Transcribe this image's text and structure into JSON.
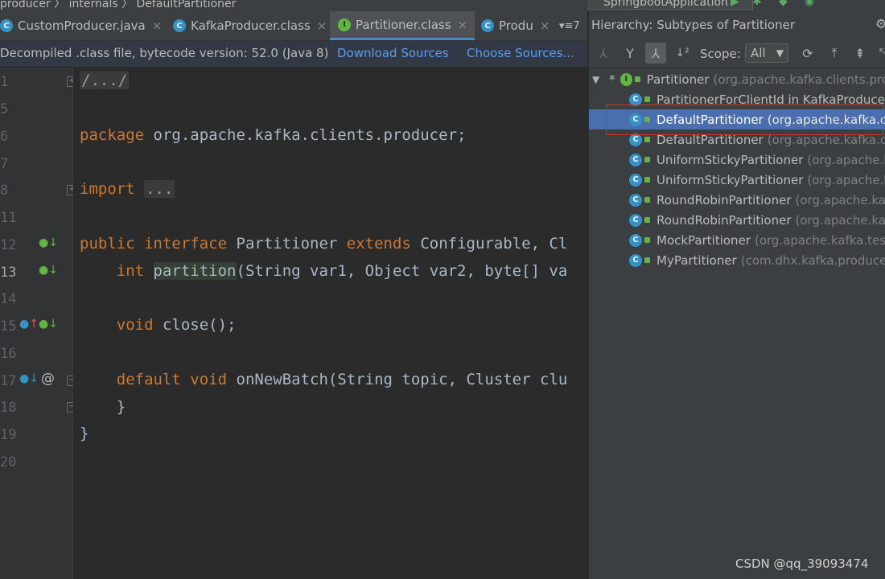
{
  "breadcrumb": {
    "text": "producer 〉 internals 〉 DefaultPartitioner"
  },
  "run_config": "SpringbootApplication",
  "tabs": [
    {
      "label": "CustomProducer.java",
      "icon": "C"
    },
    {
      "label": "KafkaProducer.class",
      "icon": "C"
    },
    {
      "label": "Partitioner.class",
      "icon": "I"
    },
    {
      "label": "Produ",
      "icon": "C"
    }
  ],
  "tab_overflow": "≡7",
  "banner": {
    "message": "Decompiled .class file, bytecode version: 52.0 (Java 8)",
    "download_sources": "Download Sources",
    "choose_sources": "Choose Sources..."
  },
  "editor": {
    "line_numbers": [
      "1",
      "5",
      "6",
      "7",
      "8",
      "11",
      "12",
      "13",
      "14",
      "15",
      "16",
      "17",
      "18",
      "19",
      "20"
    ],
    "collapsed_header": "/.../",
    "pkg_kw": "package",
    "pkg_name": " org.apache.kafka.clients.producer;",
    "import_kw": "import",
    "import_collapsed": "...",
    "line12_kw1": "public",
    "line12_kw2": "interface",
    "line12_name": "Partitioner",
    "line12_kw3": "extends",
    "line12_rest": "Configurable, Cl",
    "line13_kw": "int",
    "line13_method": "partition",
    "line13_rest": "(String var1, Object var2, byte[] va",
    "line15_kw": "void",
    "line15_rest": "close();",
    "line17_kw1": "default",
    "line17_kw2": "void",
    "line17_rest": "onNewBatch(String topic, Cluster clu",
    "brace_inner": "}",
    "brace_outer": "}"
  },
  "hierarchy": {
    "title": "Hierarchy:  Subtypes of Partitioner",
    "scope_label": "Scope:",
    "scope_value": "All",
    "root": {
      "name": "Partitioner",
      "pkg": "(org.apache.kafka.clients.pro"
    },
    "items": [
      {
        "name": "PartitionerForClientId in KafkaProducer",
        "pkg": ""
      },
      {
        "name": "DefaultPartitioner",
        "pkg": "(org.apache.kafka.cli",
        "selected": true
      },
      {
        "name": "DefaultPartitioner",
        "pkg": "(org.apache.kafka.cl"
      },
      {
        "name": "UniformStickyPartitioner",
        "pkg": "(org.apache.ka"
      },
      {
        "name": "UniformStickyPartitioner",
        "pkg": "(org.apache.ka"
      },
      {
        "name": "RoundRobinPartitioner",
        "pkg": "(org.apache.ka"
      },
      {
        "name": "RoundRobinPartitioner",
        "pkg": "(org.apache.ka"
      },
      {
        "name": "MockPartitioner",
        "pkg": "(org.apache.kafka.tes"
      },
      {
        "name": "MyPartitioner",
        "pkg": "(com.dhx.kafka.produce"
      }
    ]
  },
  "watermark": "CSDN @qq_39093474",
  "colors": {
    "selection": "#4b6eaf",
    "keyword": "#cc7832",
    "link": "#589df6",
    "highlight_box": "#d9302c"
  }
}
